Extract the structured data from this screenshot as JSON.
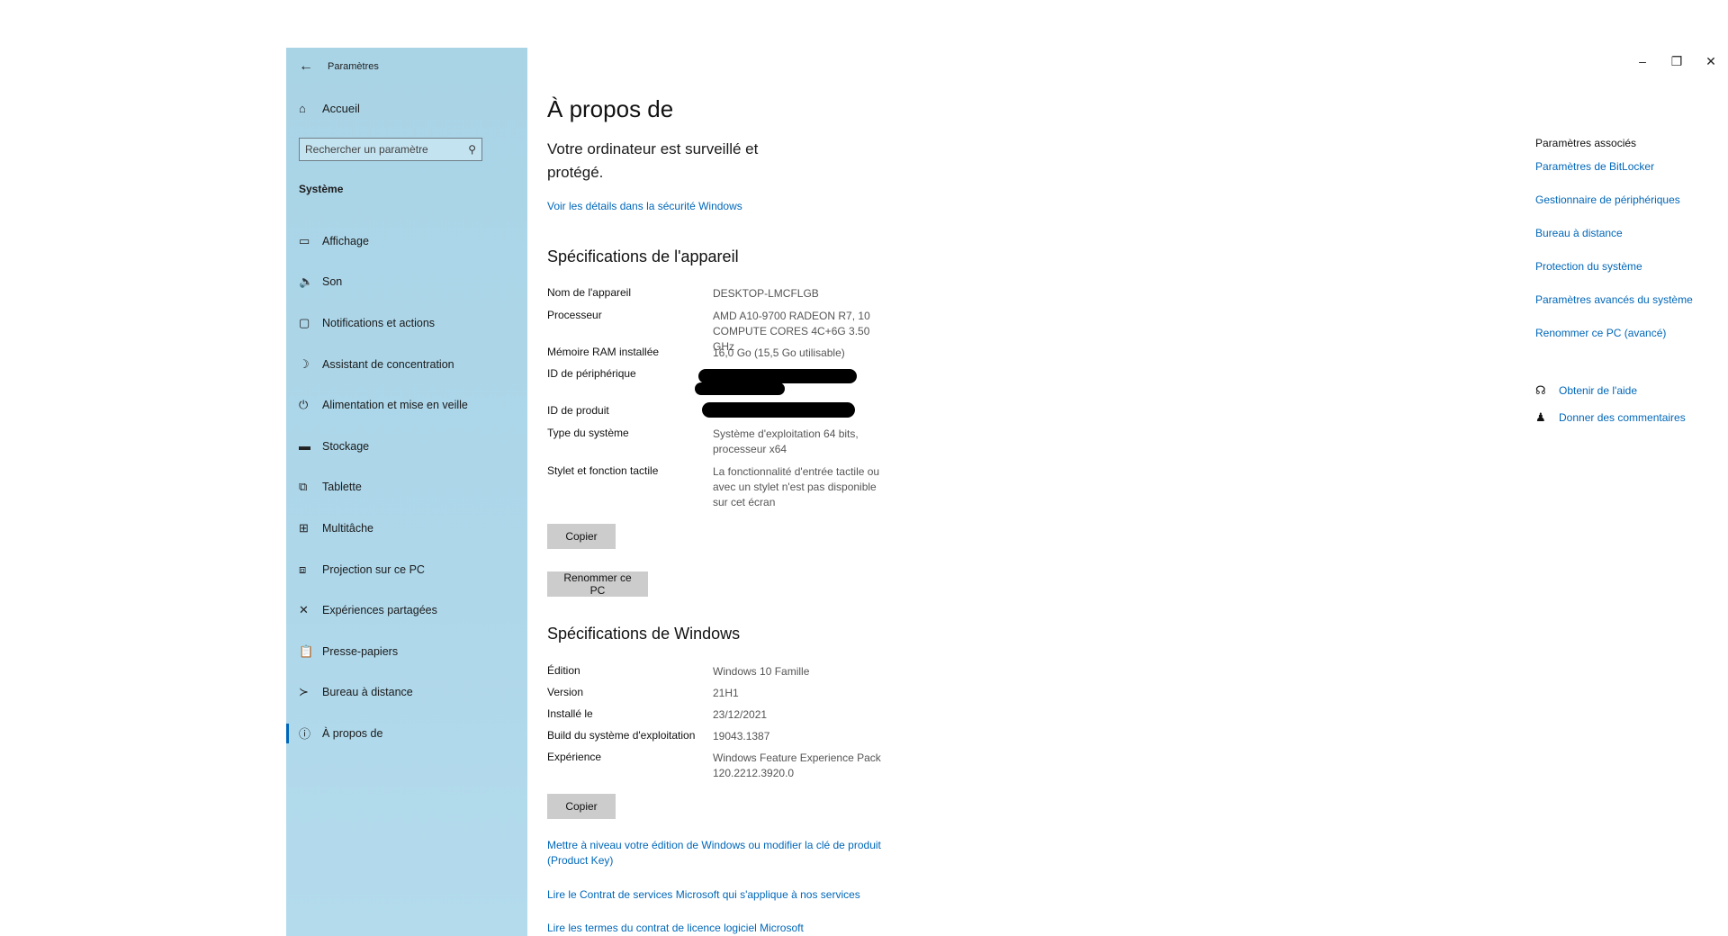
{
  "window": {
    "title": "Paramètres",
    "controls": {
      "minimize": "–",
      "restore": "❐",
      "close": "✕"
    }
  },
  "sidebar": {
    "back_icon": "back-arrow-icon",
    "home_label": "Accueil",
    "search_placeholder": "Rechercher un paramètre",
    "section_title": "Système",
    "items": [
      {
        "label": "Affichage",
        "icon": "monitor-icon",
        "glyph": "▭"
      },
      {
        "label": "Son",
        "icon": "speaker-icon",
        "glyph": "🔈"
      },
      {
        "label": "Notifications et actions",
        "icon": "notification-icon",
        "glyph": "▢"
      },
      {
        "label": "Assistant de concentration",
        "icon": "moon-icon",
        "glyph": "☽"
      },
      {
        "label": "Alimentation et mise en veille",
        "icon": "power-icon",
        "glyph": "⏻"
      },
      {
        "label": "Stockage",
        "icon": "storage-icon",
        "glyph": "▬"
      },
      {
        "label": "Tablette",
        "icon": "tablet-icon",
        "glyph": "⧉"
      },
      {
        "label": "Multitâche",
        "icon": "multitask-icon",
        "glyph": "⊞"
      },
      {
        "label": "Projection sur ce PC",
        "icon": "projection-icon",
        "glyph": "⧈"
      },
      {
        "label": "Expériences partagées",
        "icon": "shared-icon",
        "glyph": "✕"
      },
      {
        "label": "Presse-papiers",
        "icon": "clipboard-icon",
        "glyph": "📋"
      },
      {
        "label": "Bureau à distance",
        "icon": "remote-desktop-icon",
        "glyph": "≻"
      },
      {
        "label": "À propos de",
        "icon": "info-icon",
        "glyph": "ⓘ",
        "active": true
      }
    ]
  },
  "main": {
    "title": "À propos de",
    "protection_text": "Votre ordinateur est surveillé et protégé.",
    "security_link": "Voir les détails dans la sécurité Windows",
    "device_specs": {
      "heading": "Spécifications de l'appareil",
      "rows": [
        {
          "key": "Nom de l'appareil",
          "value": "DESKTOP-LMCFLGB"
        },
        {
          "key": "Processeur",
          "value": "AMD A10-9700 RADEON R7, 10 COMPUTE CORES 4C+6G   3.50 GHz"
        },
        {
          "key": "Mémoire RAM installée",
          "value": "16,0 Go (15,5 Go utilisable)"
        },
        {
          "key": "ID de périphérique",
          "value": ""
        },
        {
          "key": "ID de produit",
          "value": ""
        },
        {
          "key": "Type du système",
          "value": "Système d'exploitation 64 bits, processeur x64"
        },
        {
          "key": "Stylet et fonction tactile",
          "value": "La fonctionnalité d'entrée tactile ou avec un stylet n'est pas disponible sur cet écran"
        }
      ],
      "copy_button": "Copier",
      "rename_button": "Renommer ce PC"
    },
    "windows_specs": {
      "heading": "Spécifications de Windows",
      "rows": [
        {
          "key": "Édition",
          "value": "Windows 10 Famille"
        },
        {
          "key": "Version",
          "value": "21H1"
        },
        {
          "key": "Installé le",
          "value": "23/12/2021"
        },
        {
          "key": "Build du système d'exploitation",
          "value": "19043.1387"
        },
        {
          "key": "Expérience",
          "value": "Windows Feature Experience Pack 120.2212.3920.0"
        }
      ],
      "copy_button": "Copier"
    },
    "links": [
      "Mettre à niveau votre édition de Windows ou modifier la clé de produit (Product Key)",
      "Lire le Contrat de services Microsoft qui s'applique à nos services",
      "Lire les termes du contrat de licence logiciel Microsoft"
    ]
  },
  "related": {
    "title": "Paramètres associés",
    "links": [
      "Paramètres de BitLocker",
      "Gestionnaire de périphériques",
      "Bureau à distance",
      "Protection du système",
      "Paramètres avancés du système",
      "Renommer ce PC (avancé)"
    ],
    "help": {
      "label": "Obtenir de l'aide",
      "icon": "help-icon"
    },
    "feedback": {
      "label": "Donner des commentaires",
      "icon": "feedback-icon"
    }
  },
  "colors": {
    "accent": "#0067b8",
    "sidebar_bg": "#aed7ea",
    "button_bg": "#cccccc"
  }
}
